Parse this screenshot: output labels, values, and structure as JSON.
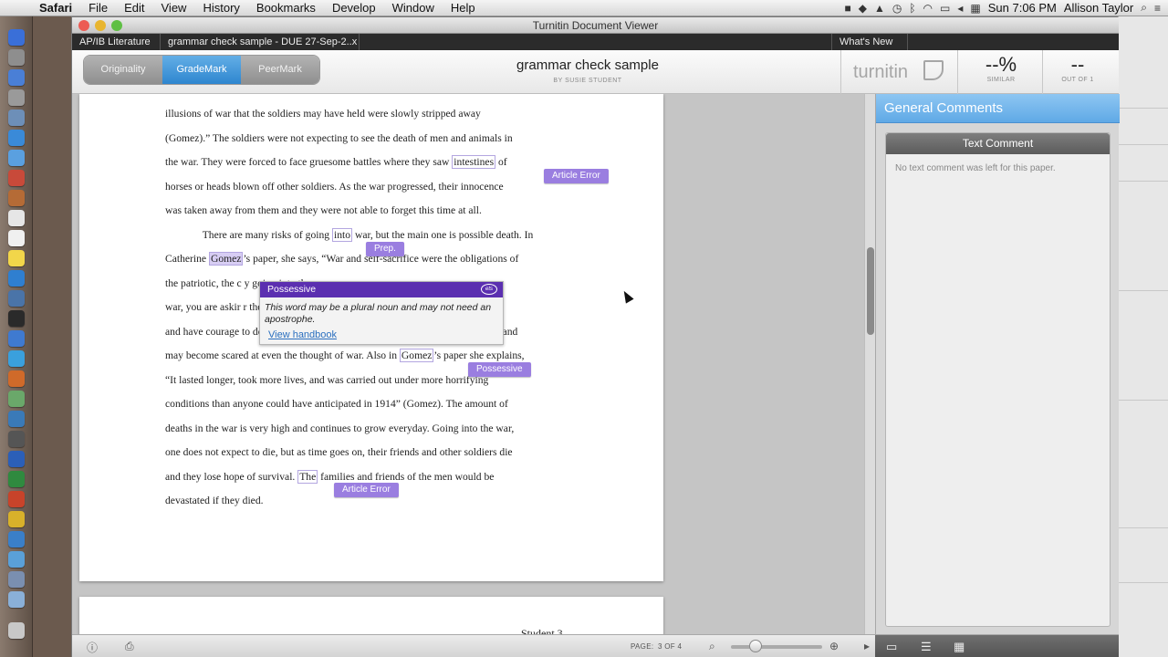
{
  "menubar": {
    "app": "Safari",
    "items": [
      "File",
      "Edit",
      "View",
      "History",
      "Bookmarks",
      "Develop",
      "Window",
      "Help"
    ],
    "clock": "Sun 7:06 PM",
    "user": "Allison Taylor"
  },
  "window": {
    "title": "Turnitin Document Viewer",
    "tabs": [
      "AP/IB Literature",
      "grammar check sample - DUE 27-Sep-2..x",
      "What's New"
    ]
  },
  "header": {
    "modes": [
      "Originality",
      "GradeMark",
      "PeerMark"
    ],
    "active_mode": "GradeMark",
    "doc_title": "grammar check sample",
    "author": "BY SUSIE STUDENT",
    "logo": "turnitin",
    "similarity_value": "--%",
    "similarity_label": "SIMILAR",
    "grade_value": "--",
    "grade_label": "OUT OF 1"
  },
  "document": {
    "lines": [
      {
        "pre": "illusions of war that the soldiers may have held were slowly stripped away",
        "mark": "",
        "post": ""
      },
      {
        "pre": "(Gomez).”  The soldiers were not expecting to see the death of men and animals in",
        "mark": "",
        "post": ""
      },
      {
        "pre": "the war. They were forced to face gruesome battles where they saw ",
        "mark": "intestines",
        "post": " of"
      },
      {
        "pre": "horses or heads blown off other soldiers. As the war progressed, their innocence",
        "mark": "",
        "post": ""
      },
      {
        "pre": "was taken away from them and they were not able to forget this time at all.",
        "mark": "",
        "post": ""
      },
      {
        "pre": "        There are many risks of going ",
        "mark": "into",
        "post": " war, but the main one is possible death. In"
      },
      {
        "pre": "Catherine ",
        "mark": "Gomez",
        "post": "’s paper, she says, “War and self-sacrifice were the obligations of"
      },
      {
        "pre": "the patriotic, the c",
        "mark": "",
        "post": "                                                                  y going into the"
      },
      {
        "pre": "war, you are askir",
        "mark": "",
        "post": "                                                                   r their country"
      },
      {
        "pre": "and have courage to do so. Some men our age do not have those characteristics and",
        "mark": "",
        "post": ""
      },
      {
        "pre": "may become scared at even the thought of war. Also in ",
        "mark": "Gomez",
        "post": "’s paper she explains,"
      },
      {
        "pre": "“It lasted longer, took more lives, and was carried out under more horrifying",
        "mark": "",
        "post": ""
      },
      {
        "pre": "conditions than anyone could have anticipated in 1914” (Gomez). The amount of",
        "mark": "",
        "post": ""
      },
      {
        "pre": "deaths in the war is very high and continues to grow everyday. Going into the war,",
        "mark": "",
        "post": ""
      },
      {
        "pre": "one does not expect to die, but as time goes on, their friends and other soldiers die",
        "mark": "",
        "post": ""
      },
      {
        "pre": "and they lose hope of survival. ",
        "mark": "The",
        "post": " families and friends of the men would be"
      },
      {
        "pre": "devastated if they died.",
        "mark": "",
        "post": ""
      }
    ],
    "tags": [
      "Article Error",
      "Prep.",
      "Possessive",
      "Article Error"
    ],
    "next_page_header": "Student    3"
  },
  "popup": {
    "title": "Possessive",
    "badge": "ets",
    "body": "This word may be a plural noun and may not need an apostrophe.",
    "link": "View handbook"
  },
  "panel": {
    "heading": "General Comments",
    "box_title": "Text Comment",
    "box_body": "No text comment was left for this paper."
  },
  "bottombar": {
    "page_label": "PAGE:",
    "page_value": "3 OF 4"
  },
  "colors": {
    "accent": "#5fa9e6",
    "tag": "#9a7ee0",
    "popup_header": "#5b2fb0"
  }
}
